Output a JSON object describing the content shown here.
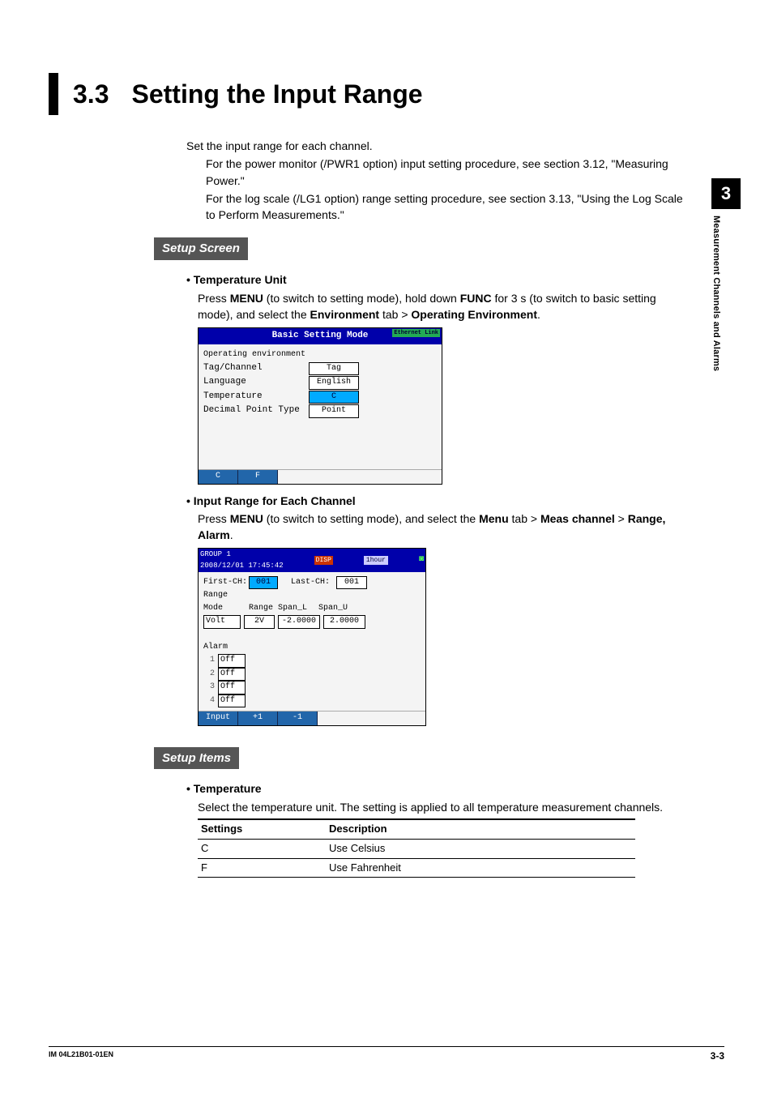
{
  "side": {
    "chapter": "3",
    "running_head": "Measurement Channels and Alarms"
  },
  "title": {
    "number": "3.3",
    "text": "Setting the Input Range"
  },
  "lead": "Set the input range for each channel.",
  "notes": {
    "n1": "For the power monitor (/PWR1 option) input setting procedure, see section 3.12, \"Measuring Power.\"",
    "n2": "For the log scale (/LG1 option) range setting procedure, see section 3.13, \"Using the Log Scale to Perform Measurements.\""
  },
  "setup_screen": {
    "label": "Setup Screen",
    "temp_unit": {
      "hd": "Temperature Unit",
      "p1a": "Press ",
      "p1b": "MENU",
      "p1c": " (to switch to setting mode), hold down ",
      "p1d": "FUNC",
      "p1e": " for 3 s (to switch to basic setting mode), and select the ",
      "p1f": "Environment",
      "p1g": " tab > ",
      "p1h": "Operating Environment",
      "p1i": "."
    },
    "screen1": {
      "title": "Basic Setting Mode",
      "eth": "Ethernet Link",
      "h": "Operating environment",
      "rows": [
        {
          "l": "Tag/Channel",
          "v": "Tag",
          "sel": false
        },
        {
          "l": "Language",
          "v": "English",
          "sel": false
        },
        {
          "l": "Temperature",
          "v": "C",
          "sel": true
        },
        {
          "l": "Decimal Point Type",
          "v": "Point",
          "sel": false
        }
      ],
      "foot": [
        "C",
        "F"
      ]
    },
    "input_range": {
      "hd": "Input Range for Each Channel",
      "p1a": "Press ",
      "p1b": "MENU",
      "p1c": " (to switch to setting mode), and select the ",
      "p1d": "Menu",
      "p1e": " tab > ",
      "p1f": "Meas channel",
      "p1g": " > ",
      "p1h": "Range, Alarm",
      "p1i": "."
    },
    "screen2": {
      "grp": "GROUP 1",
      "ts": "2008/12/01 17:45:42",
      "disp": "DISP",
      "hour": "1hour",
      "first_l": "First-CH:",
      "first_v": "001",
      "last_l": "Last-CH:",
      "last_v": "001",
      "range_hd": "Range",
      "cols": {
        "m": "Mode",
        "r": "Range",
        "sl": "Span_L",
        "su": "Span_U"
      },
      "vals": {
        "m": "Volt",
        "r": "2V",
        "sl": "-2.0000",
        "su": "2.0000"
      },
      "alarm_hd": "Alarm",
      "alarms": [
        {
          "n": "1",
          "v": "Off"
        },
        {
          "n": "2",
          "v": "Off"
        },
        {
          "n": "3",
          "v": "Off"
        },
        {
          "n": "4",
          "v": "Off"
        }
      ],
      "foot": [
        "Input",
        "+1",
        "-1"
      ]
    }
  },
  "setup_items": {
    "label": "Setup Items",
    "temp": {
      "hd": "Temperature",
      "p": "Select the temperature unit. The setting is applied to all temperature measurement channels."
    },
    "table": {
      "headers": {
        "s": "Settings",
        "d": "Description"
      },
      "rows": [
        {
          "s": "C",
          "d": "Use Celsius"
        },
        {
          "s": "F",
          "d": "Use Fahrenheit"
        }
      ]
    }
  },
  "footer": {
    "doc": "IM 04L21B01-01EN",
    "pg": "3-3"
  }
}
